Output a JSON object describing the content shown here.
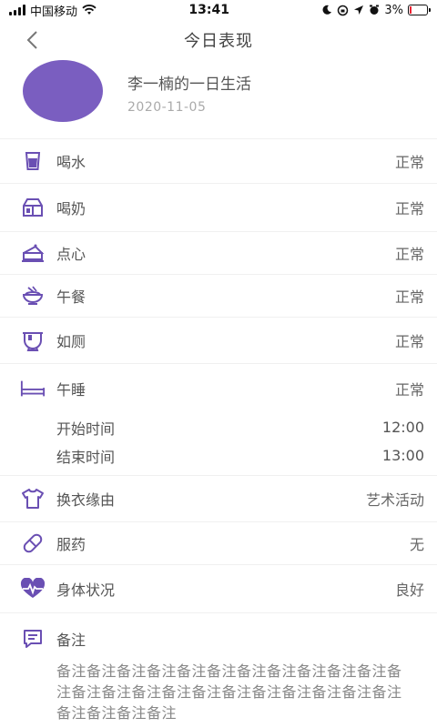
{
  "status": {
    "carrier": "中国移动",
    "time": "13:41",
    "battery": "3%"
  },
  "header": {
    "title": "今日表现"
  },
  "profile": {
    "name": "李一楠的一日生活",
    "date": "2020-11-05"
  },
  "rows": {
    "water": {
      "label": "喝水",
      "value": "正常"
    },
    "milk": {
      "label": "喝奶",
      "value": "正常"
    },
    "snack": {
      "label": "点心",
      "value": "正常"
    },
    "lunch": {
      "label": "午餐",
      "value": "正常"
    },
    "toilet": {
      "label": "如厕",
      "value": "正常"
    },
    "nap": {
      "label": "午睡",
      "value": "正常",
      "start_label": "开始时间",
      "start_value": "12:00",
      "end_label": "结束时间",
      "end_value": "13:00"
    },
    "change": {
      "label": "换衣缘由",
      "value": "艺术活动"
    },
    "medicine": {
      "label": "服药",
      "value": "无"
    },
    "health": {
      "label": "身体状况",
      "value": "良好"
    }
  },
  "note": {
    "label": "备注",
    "text": "备注备注备注备注备注备注备注备注备注备注备注备注备注备注备注备注备注备注备注备注备注备注备注备注备注备注备注"
  },
  "colors": {
    "accent": "#7a5ec0",
    "battery_low": "#ee2233"
  },
  "icons": [
    "back-icon",
    "cup-icon",
    "milk-icon",
    "cake-icon",
    "bowl-icon",
    "potty-icon",
    "bed-icon",
    "shirt-icon",
    "pill-icon",
    "heartbeat-icon",
    "note-icon"
  ]
}
